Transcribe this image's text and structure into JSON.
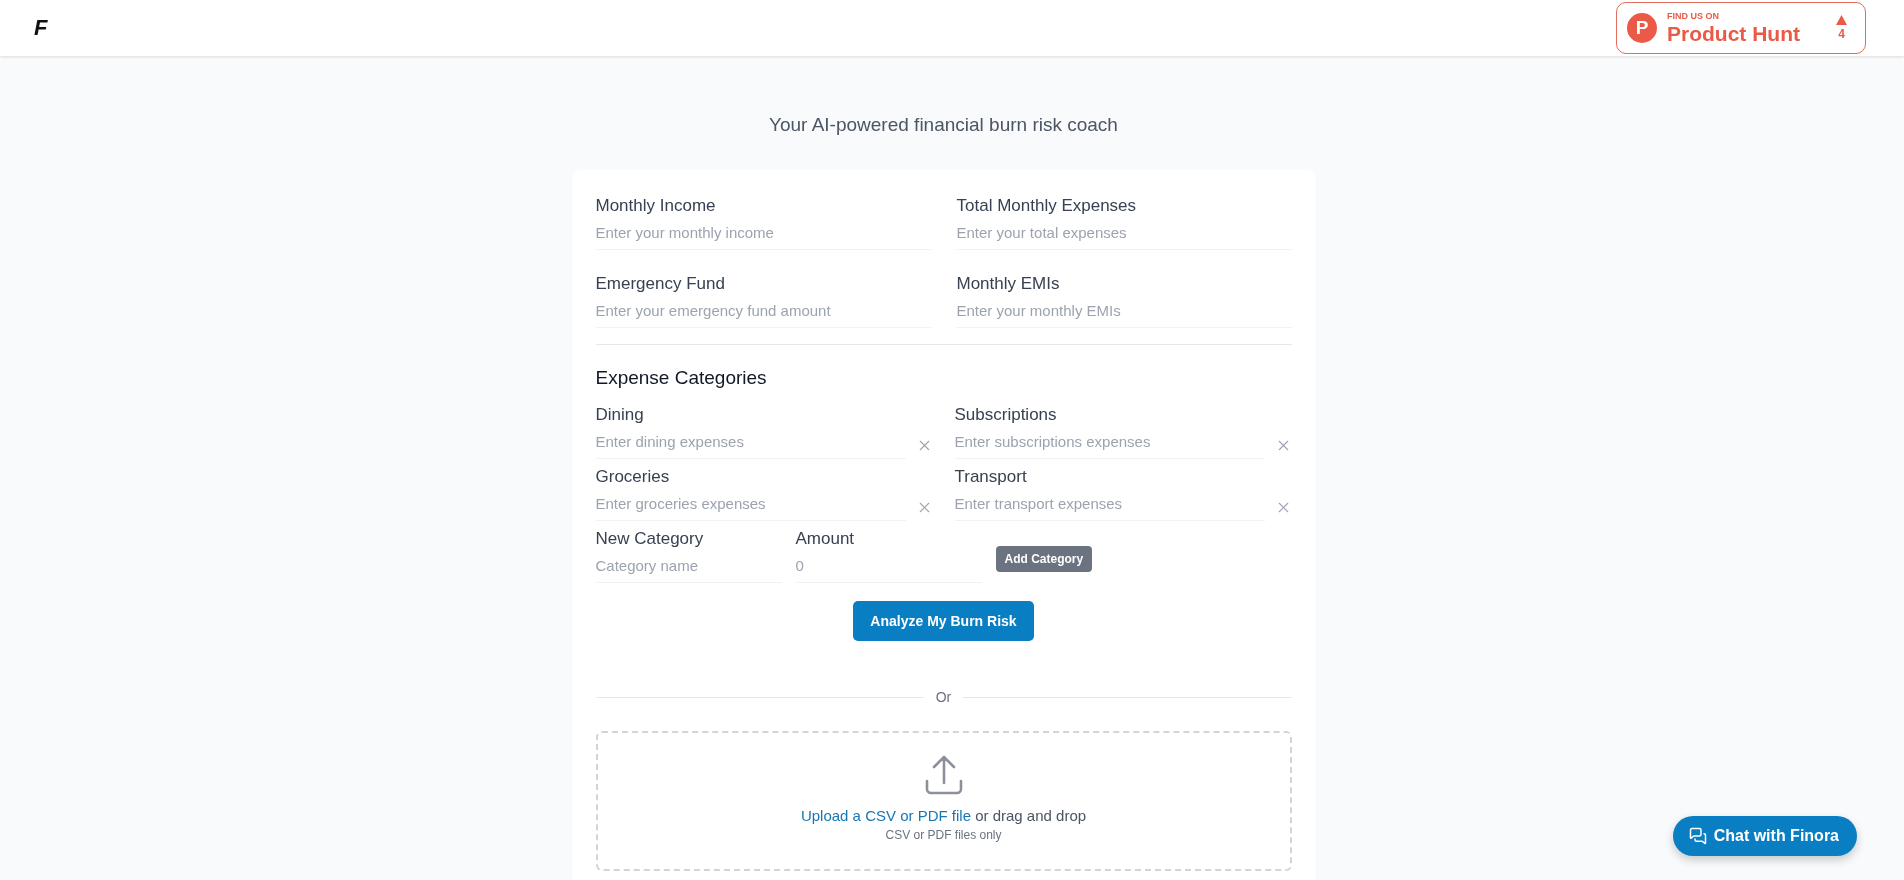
{
  "header": {
    "logo": "F",
    "badge": {
      "mark": "P",
      "eyebrow": "FIND US ON",
      "name": "Product Hunt",
      "votes": "4"
    }
  },
  "subtitle": "Your AI-powered financial burn risk coach",
  "fields": [
    {
      "label": "Monthly Income",
      "placeholder": "Enter your monthly income"
    },
    {
      "label": "Total Monthly Expenses",
      "placeholder": "Enter your total expenses"
    },
    {
      "label": "Emergency Fund",
      "placeholder": "Enter your emergency fund amount"
    },
    {
      "label": "Monthly EMIs",
      "placeholder": "Enter your monthly EMIs"
    }
  ],
  "expense_categories": {
    "title": "Expense Categories",
    "items": [
      {
        "label": "Dining",
        "placeholder": "Enter dining expenses"
      },
      {
        "label": "Subscriptions",
        "placeholder": "Enter subscriptions expenses"
      },
      {
        "label": "Groceries",
        "placeholder": "Enter groceries expenses"
      },
      {
        "label": "Transport",
        "placeholder": "Enter transport expenses"
      }
    ],
    "new_category": {
      "name_label": "New Category",
      "name_placeholder": "Category name",
      "amount_label": "Amount",
      "amount_placeholder": "0",
      "button": "Add Category"
    }
  },
  "analyze_button": "Analyze My Burn Risk",
  "divider_text": "Or",
  "upload": {
    "link": "Upload a CSV or PDF file",
    "text": " or drag and drop",
    "hint": "CSV or PDF files only"
  },
  "chat_button": "Chat with Finora"
}
